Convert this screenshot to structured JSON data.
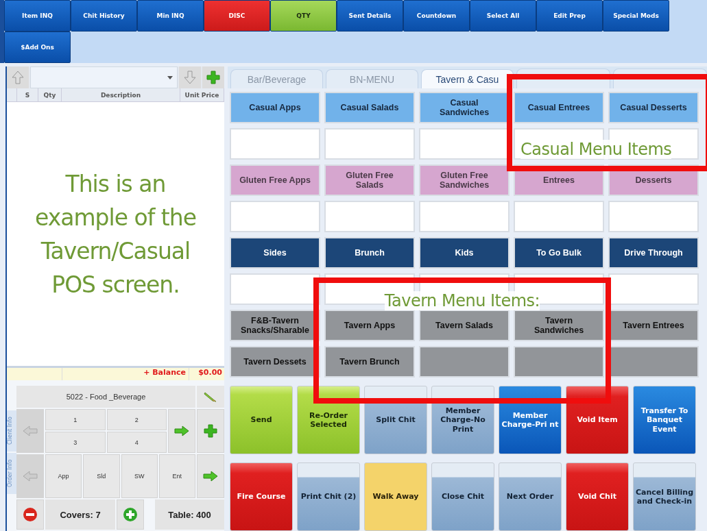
{
  "toolbar": [
    {
      "label": "Item INQ",
      "kind": "blue"
    },
    {
      "label": "Chit History",
      "kind": "blue"
    },
    {
      "label": "Min INQ",
      "kind": "blue"
    },
    {
      "label": "DISC",
      "kind": "red"
    },
    {
      "label": "QTY",
      "kind": "green"
    },
    {
      "label": "Sent Details",
      "kind": "blue"
    },
    {
      "label": "Countdown",
      "kind": "blue"
    },
    {
      "label": "Select All",
      "kind": "blue"
    },
    {
      "label": "Edit Prep",
      "kind": "blue"
    },
    {
      "label": "Special Mods",
      "kind": "blue"
    },
    {
      "label": "$Add Ons",
      "kind": "blue"
    }
  ],
  "order_panel": {
    "columns": [
      "S",
      "Qty",
      "Description",
      "Unit Price"
    ],
    "annotation": "This is an example of the Tavern/Casual POS screen.",
    "balance_label": "+ Balance",
    "balance": "$0.00",
    "account": "5022 - Food _Beverage",
    "side_tabs": [
      "Client Info",
      "Order Info"
    ],
    "seats": [
      "1",
      "2",
      "3",
      "4"
    ],
    "courses": [
      "App",
      "Sld",
      "SW",
      "Ent"
    ],
    "covers": "Covers: 7",
    "table": "Table: 400"
  },
  "menu_tabs": [
    {
      "label": "Bar/Beverage",
      "selected": false
    },
    {
      "label": "BN-MENU",
      "selected": false
    },
    {
      "label": "Tavern & Casu",
      "selected": true
    }
  ],
  "menu_rows": [
    [
      {
        "label": "Casual Apps",
        "kind": "casual"
      },
      {
        "label": "Casual Salads",
        "kind": "casual"
      },
      {
        "label": "Casual Sandwiches",
        "kind": "casual"
      },
      {
        "label": "Casual Entrees",
        "kind": "casual"
      },
      {
        "label": "Casual Desserts",
        "kind": "casual"
      }
    ],
    [
      {
        "kind": "blank"
      },
      {
        "kind": "blank"
      },
      {
        "kind": "blank"
      },
      {
        "kind": "blank"
      },
      {
        "kind": "blank"
      }
    ],
    [
      {
        "label": "Gluten Free Apps",
        "kind": "gluten"
      },
      {
        "label": "Gluten Free Salads",
        "kind": "gluten"
      },
      {
        "label": "Gluten Free Sandwiches",
        "kind": "gluten"
      },
      {
        "label": "Entrees",
        "kind": "gluten"
      },
      {
        "label": "Desserts",
        "kind": "gluten"
      }
    ],
    [
      {
        "kind": "blank"
      },
      {
        "kind": "blank"
      },
      {
        "kind": "blank"
      },
      {
        "kind": "blank"
      },
      {
        "kind": "blank"
      }
    ],
    [
      {
        "label": "Sides",
        "kind": "dark"
      },
      {
        "label": "Brunch",
        "kind": "dark"
      },
      {
        "label": "Kids",
        "kind": "dark"
      },
      {
        "label": "To Go Bulk",
        "kind": "dark"
      },
      {
        "label": "Drive Through",
        "kind": "dark"
      }
    ],
    [
      {
        "kind": "blank"
      },
      {
        "kind": "blank"
      },
      {
        "kind": "blank"
      },
      {
        "kind": "blank"
      },
      {
        "kind": "blank"
      }
    ],
    [
      {
        "label": "F&B-Tavern Snacks/Sharable",
        "kind": "tavern"
      },
      {
        "label": "Tavern Apps",
        "kind": "tavern"
      },
      {
        "label": "Tavern Salads",
        "kind": "tavern"
      },
      {
        "label": "Tavern Sandwiches",
        "kind": "tavern"
      },
      {
        "label": "Tavern Entrees",
        "kind": "tavern"
      }
    ],
    [
      {
        "label": "Tavern Dessets",
        "kind": "tavern"
      },
      {
        "label": "Tavern Brunch",
        "kind": "tavern"
      },
      {
        "kind": "tavern"
      },
      {
        "kind": "tavern"
      },
      {
        "kind": "tavern"
      }
    ]
  ],
  "actions": [
    [
      {
        "label": "Send",
        "kind": "green"
      },
      {
        "label": "Re-Order Selected",
        "kind": "green"
      },
      {
        "label": "Split Chit",
        "kind": "steel"
      },
      {
        "label": "Member Charge-No Print",
        "kind": "steel"
      },
      {
        "label": "Member Charge-Pri nt",
        "kind": "blue"
      },
      {
        "label": "Void Item",
        "kind": "red"
      },
      {
        "label": "Transfer To Banquet Event",
        "kind": "blue"
      }
    ],
    [
      {
        "label": "Fire Course",
        "kind": "red"
      },
      {
        "label": "Print Chit (2)",
        "kind": "steel"
      },
      {
        "label": "Walk Away",
        "kind": "yellow"
      },
      {
        "label": "Close Chit",
        "kind": "steel"
      },
      {
        "label": "Next Order",
        "kind": "steel"
      },
      {
        "label": "Void Chit",
        "kind": "red"
      },
      {
        "label": "Cancel Billing and Check-in",
        "kind": "steel"
      }
    ]
  ],
  "callouts": [
    {
      "text": "Casual Menu Items",
      "kind": "casual"
    },
    {
      "text": "Tavern Menu Items:",
      "kind": "tavern"
    }
  ]
}
